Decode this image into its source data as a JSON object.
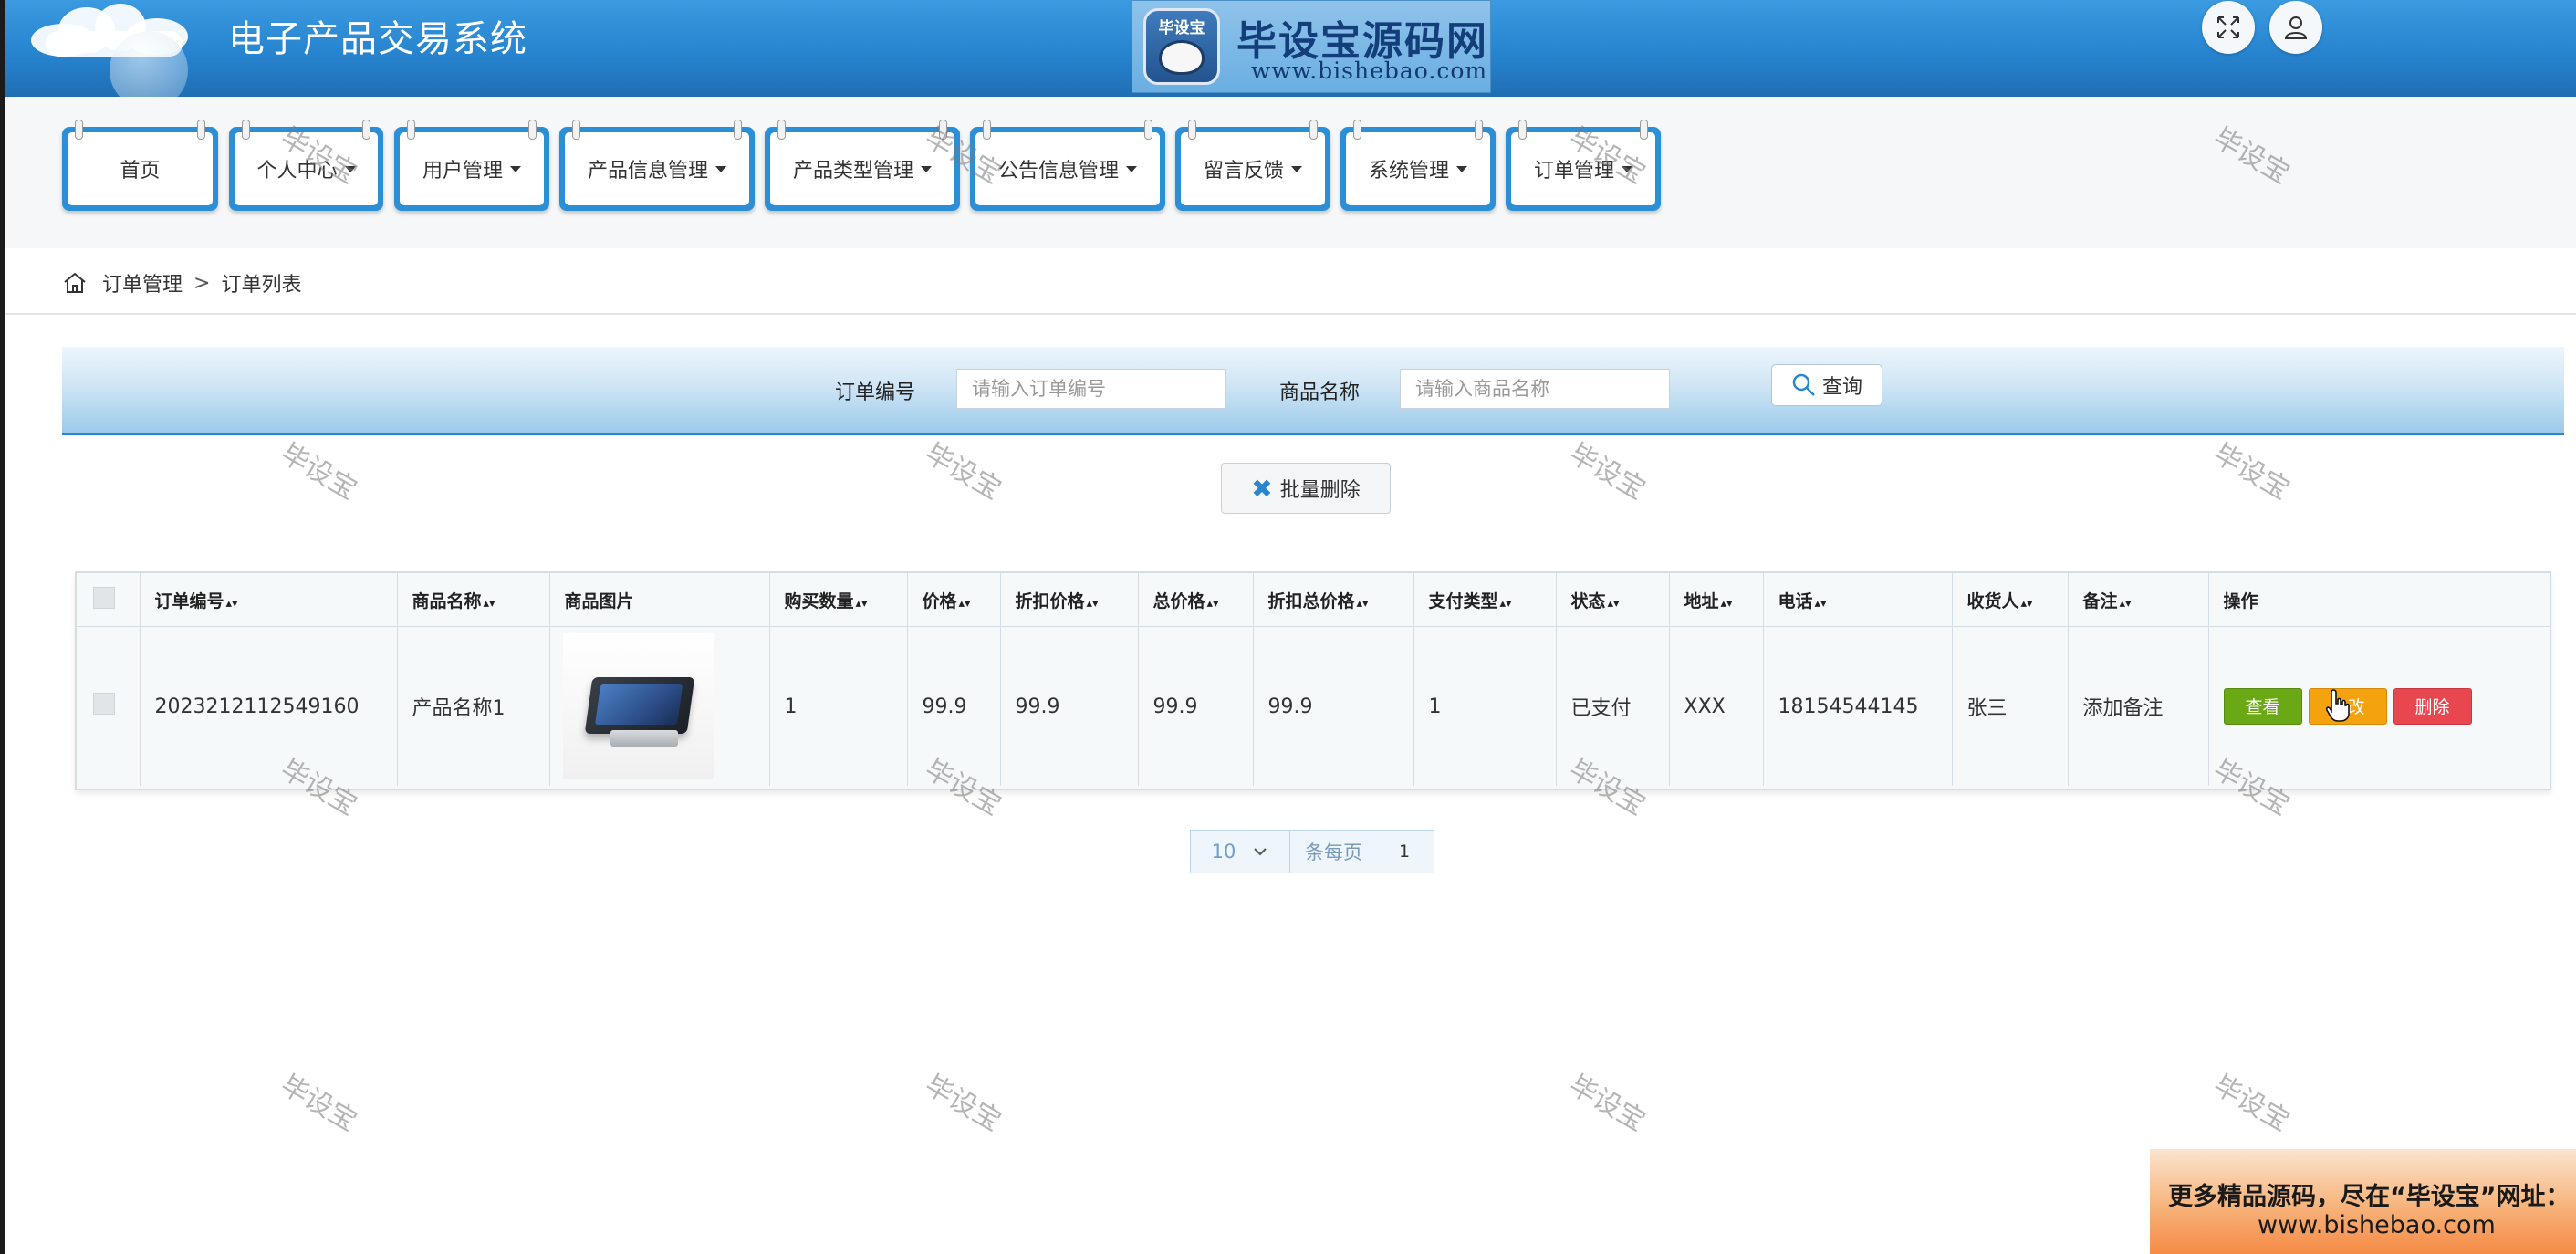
{
  "header": {
    "app_title": "电子产品交易系统",
    "brand": {
      "logo_text": "毕设宝",
      "name": "毕设宝源码网",
      "url": "www.bishebao.com"
    },
    "icons": [
      "fullscreen-icon",
      "user-icon"
    ]
  },
  "nav": {
    "items": [
      {
        "label": "首页",
        "dropdown": false
      },
      {
        "label": "个人中心",
        "dropdown": true
      },
      {
        "label": "用户管理",
        "dropdown": true
      },
      {
        "label": "产品信息管理",
        "dropdown": true
      },
      {
        "label": "产品类型管理",
        "dropdown": true
      },
      {
        "label": "公告信息管理",
        "dropdown": true
      },
      {
        "label": "留言反馈",
        "dropdown": true
      },
      {
        "label": "系统管理",
        "dropdown": true
      },
      {
        "label": "订单管理",
        "dropdown": true
      }
    ]
  },
  "breadcrumb": {
    "parent": "订单管理",
    "separator": ">",
    "current": "订单列表"
  },
  "search": {
    "order_no_label": "订单编号",
    "order_no_placeholder": "请输入订单编号",
    "product_name_label": "商品名称",
    "product_name_placeholder": "请输入商品名称",
    "button_label": "查询"
  },
  "batch_delete_label": "批量删除",
  "table": {
    "columns": [
      "订单编号",
      "商品名称",
      "商品图片",
      "购买数量",
      "价格",
      "折扣价格",
      "总价格",
      "折扣总价格",
      "支付类型",
      "状态",
      "地址",
      "电话",
      "收货人",
      "备注",
      "操作"
    ],
    "sortable": [
      true,
      true,
      false,
      true,
      true,
      true,
      true,
      true,
      true,
      true,
      true,
      true,
      true,
      true,
      false
    ],
    "rows": [
      {
        "order_no": "2023212112549160",
        "product_name": "产品名称1",
        "quantity": "1",
        "price": "99.9",
        "discount_price": "99.9",
        "total_price": "99.9",
        "discount_total": "99.9",
        "pay_type": "1",
        "status": "已支付",
        "address": "XXX",
        "phone": "18154544145",
        "receiver": "张三",
        "remark": "添加备注",
        "actions": {
          "view": "查看",
          "edit": "修改",
          "delete": "删除"
        }
      }
    ]
  },
  "pagination": {
    "page_size": "10",
    "per_page_label": "条每页",
    "current_page": "1"
  },
  "watermark_text": "毕设宝",
  "ad": {
    "line1": "更多精品源码，尽在“毕设宝”网址：",
    "line2": "www.bishebao.com"
  },
  "colors": {
    "header_blue": "#2784cf",
    "view_green": "#6aa815",
    "edit_orange": "#f4a20d",
    "delete_red": "#e8474f"
  }
}
